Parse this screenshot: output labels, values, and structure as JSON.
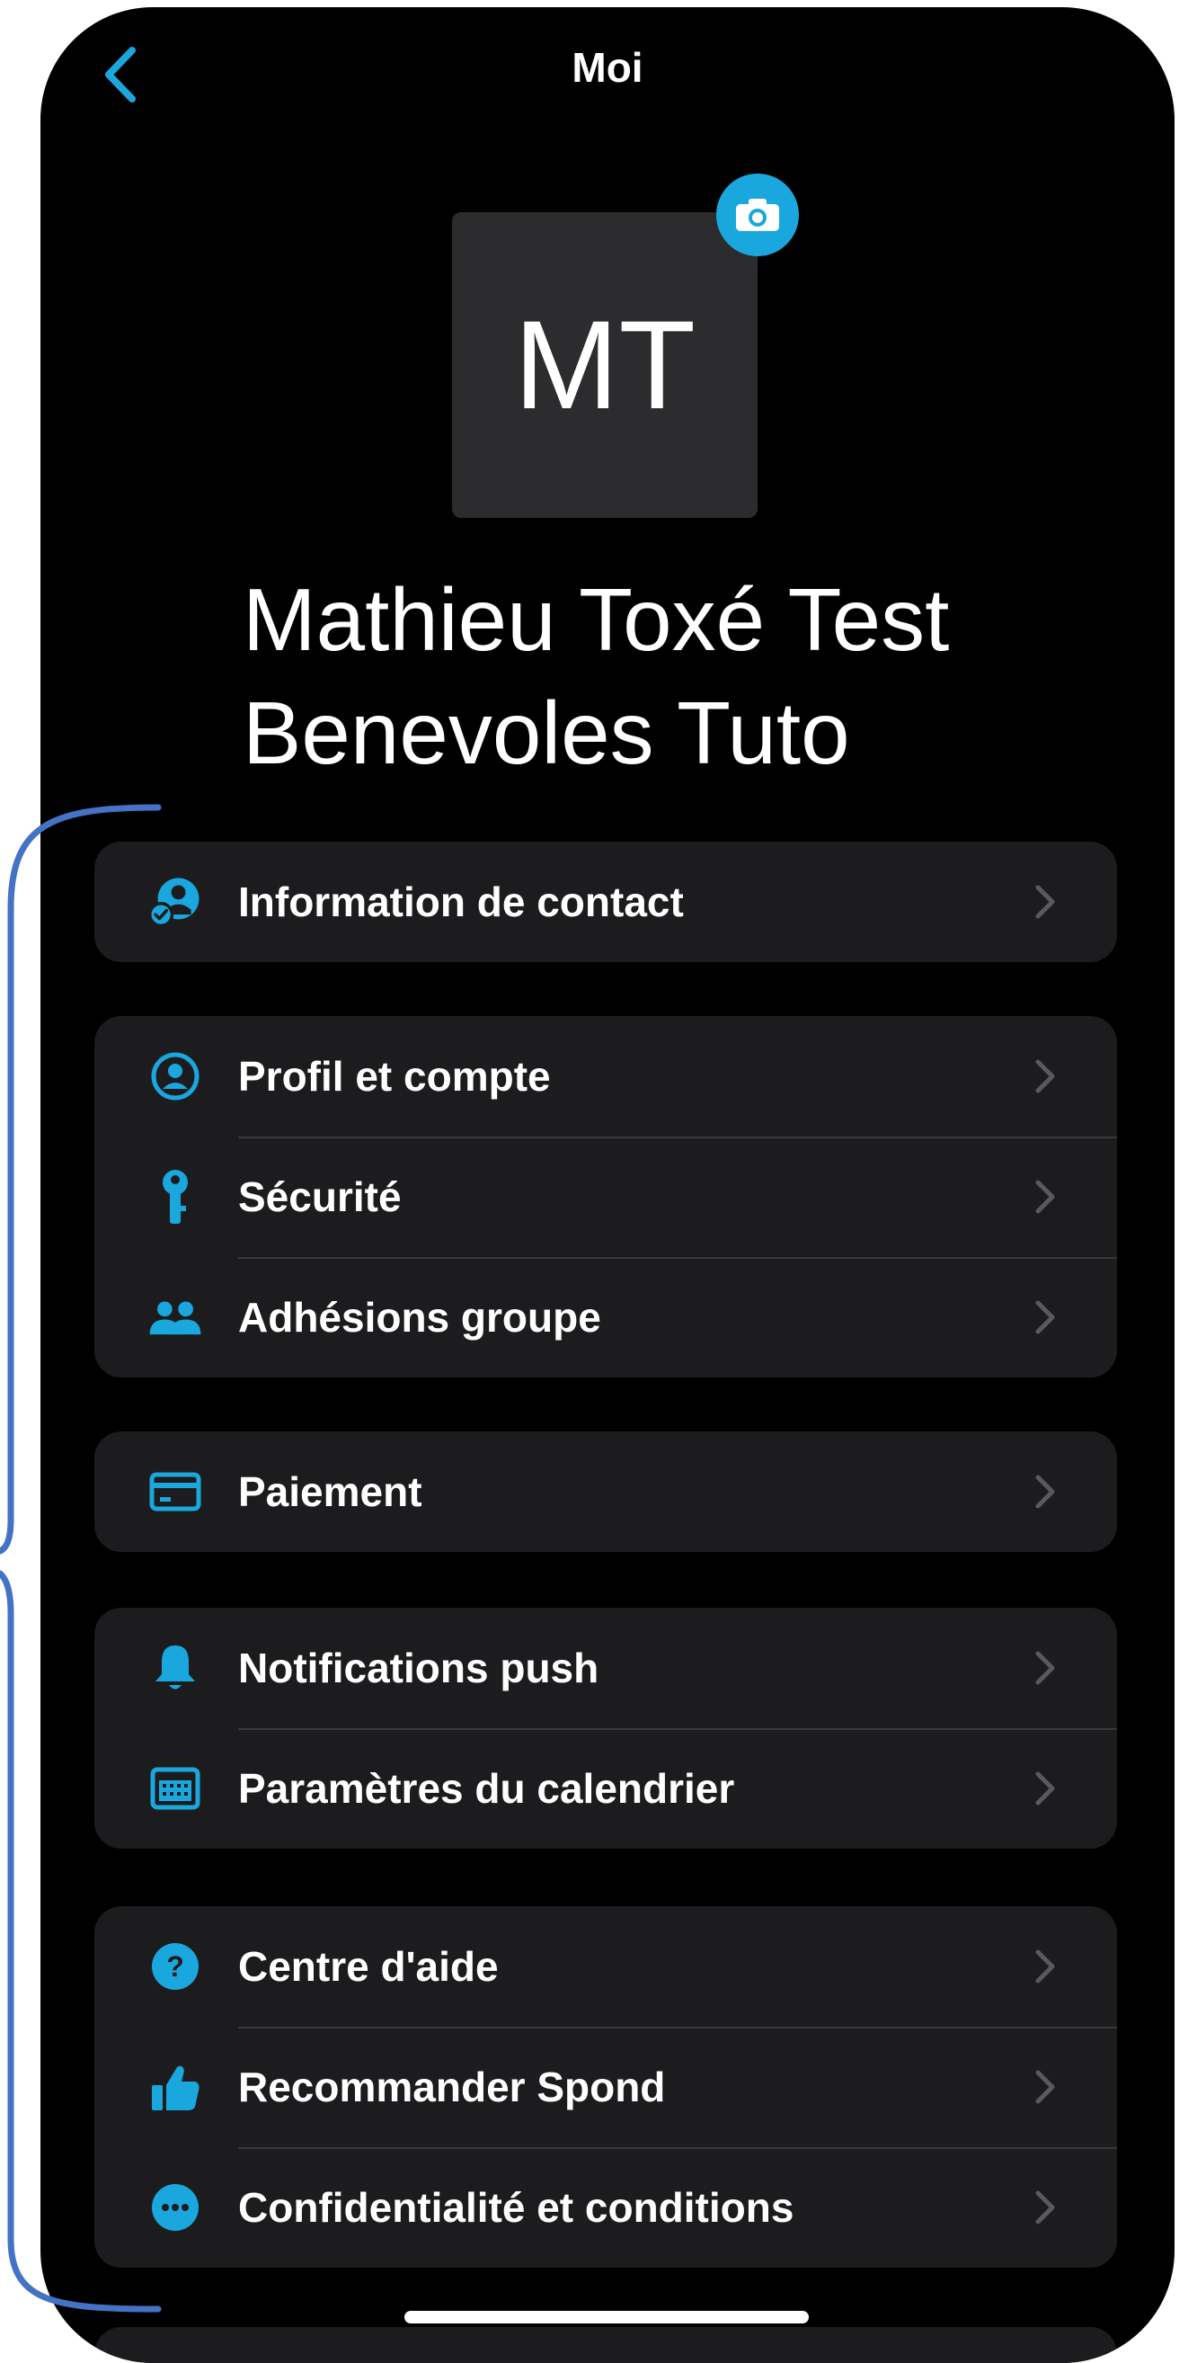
{
  "header": {
    "back_icon": "chevron-left-icon",
    "title": "Moi"
  },
  "profile": {
    "initials": "MT",
    "camera_icon": "camera-icon",
    "name": "Mathieu Toxé Test Benevoles Tuto"
  },
  "colors": {
    "accent": "#1aa7de",
    "background": "#000000",
    "card": "#1c1c1e",
    "annotation": "#4472c4"
  },
  "menu": {
    "contact": {
      "label": "Information de contact",
      "icon": "contact-check-icon"
    },
    "account": {
      "items": [
        {
          "label": "Profil et compte",
          "icon": "user-circle-icon"
        },
        {
          "label": "Sécurité",
          "icon": "key-icon"
        },
        {
          "label": "Adhésions groupe",
          "icon": "group-icon"
        }
      ]
    },
    "payment": {
      "label": "Paiement",
      "icon": "credit-card-icon"
    },
    "settings": {
      "items": [
        {
          "label": "Notifications push",
          "icon": "bell-icon"
        },
        {
          "label": "Paramètres du calendrier",
          "icon": "calendar-icon"
        }
      ]
    },
    "support": {
      "items": [
        {
          "label": "Centre d'aide",
          "icon": "help-icon"
        },
        {
          "label": "Recommander Spond",
          "icon": "thumbs-up-icon"
        },
        {
          "label": "Confidentialité et conditions",
          "icon": "more-dots-icon"
        }
      ]
    }
  }
}
